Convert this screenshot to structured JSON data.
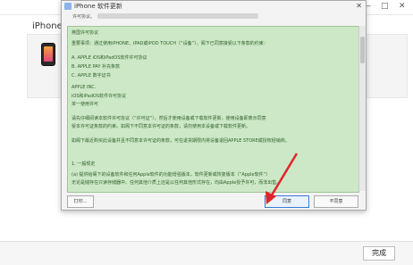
{
  "window_controls": {
    "minimize": "—",
    "maximize": "□",
    "close": "✕"
  },
  "device": {
    "name": "iPhone 1"
  },
  "bottom_bar": {
    "done_label": "完成"
  },
  "dialog": {
    "title": "iPhone 软件更新",
    "close_label": "✕",
    "subtitle": "许可协议。",
    "lines": [
      "英国许可协议",
      "重要事项：通过使用iPHONE、iPAD或iPOD TOUCH（“设备”），阁下已同意接受以下条款的约束：",
      "A.   APPLE iOS和iPadOS软件许可协议",
      "B.   APPLE PAY 补充条款",
      "C.   APPLE 数字证书",
      "APPLE INC.",
      "iOS和iPadOS软件许可协议",
      "单一使用许可",
      "请先仔细阅读本软件许可协议（“许可证”），然后才使用设备或下载软件更新，使用设备即表示同意",
      "受本许可证条款的约束。如阁下不同意本许可证的条款，请勿使用本设备或下载软件更新。",
      "如阁下最近购买此设备并且不同意本许可证的条款，可在退货期限内将设备退回APPLE STORE或授权经销商。",
      "1. 一般规定",
      "(a) 提供给阁下的设备软件和任何Apple软件的功能增强版本，软件更新或恢复版本（“Apple软件”）",
      "无论是储存在只读存储器中、任何其他介质上还是以任何其他形式存在，均由Apple授予许可，而非出售。"
    ],
    "buttons": {
      "print": "打印...",
      "agree": "同意",
      "disagree": "不同意"
    }
  }
}
